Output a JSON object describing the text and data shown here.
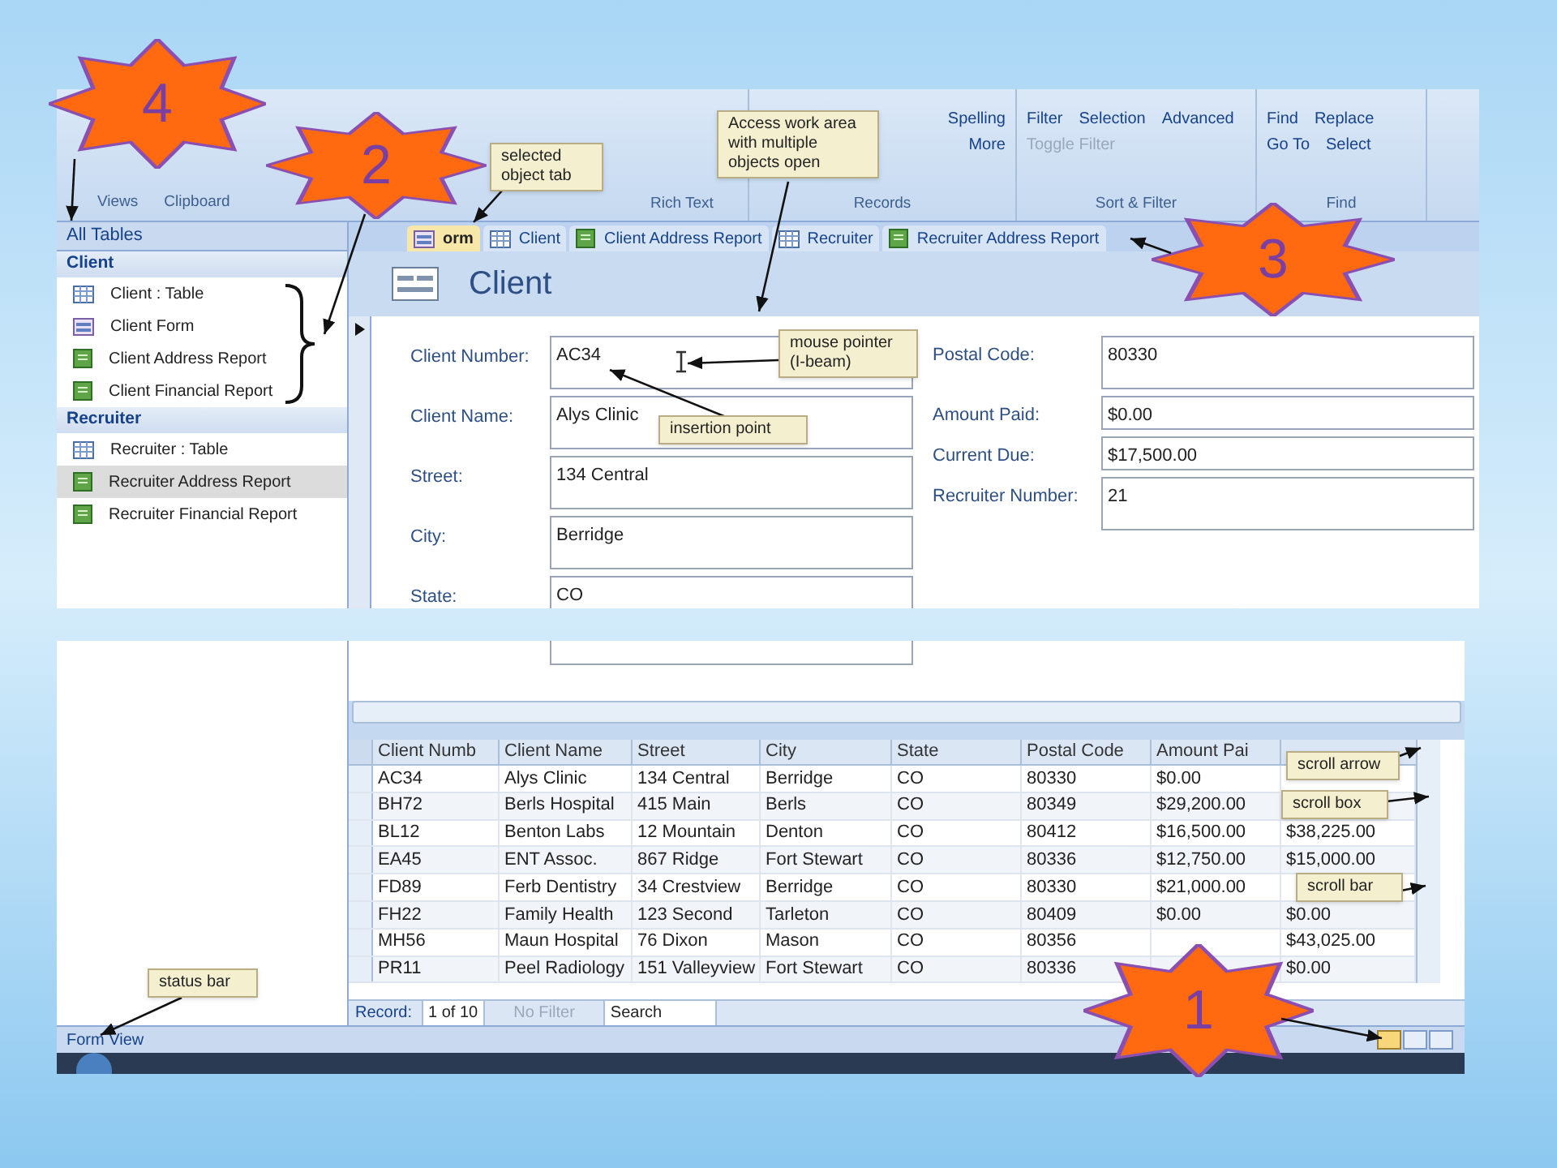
{
  "ribbon": {
    "groups": [
      {
        "label": "Views"
      },
      {
        "label": "Clipboard"
      },
      {
        "label": "Rich Text"
      },
      {
        "label": "Records",
        "buttons": [
          {
            "label": "Spelling",
            "disabled": false
          },
          {
            "label": "More",
            "disabled": false
          }
        ]
      },
      {
        "label": "Sort & Filter",
        "buttons": [
          {
            "label": "Filter",
            "disabled": false
          },
          {
            "label": "Selection",
            "disabled": false
          },
          {
            "label": "Advanced",
            "disabled": false
          },
          {
            "label": "Toggle Filter",
            "disabled": true
          }
        ]
      },
      {
        "label": "Find",
        "buttons": [
          {
            "label": "Find",
            "disabled": false
          },
          {
            "label": "Replace",
            "disabled": false
          },
          {
            "label": "Go To",
            "disabled": false
          },
          {
            "label": "Select",
            "disabled": false
          }
        ]
      }
    ]
  },
  "nav_pane": {
    "title": "All Tables",
    "groups": [
      {
        "label": "Client",
        "items": [
          {
            "label": "Client : Table",
            "kind": "table",
            "selected": false
          },
          {
            "label": "Client Form",
            "kind": "form",
            "selected": false
          },
          {
            "label": "Client Address Report",
            "kind": "report",
            "selected": false
          },
          {
            "label": "Client Financial Report",
            "kind": "report",
            "selected": false
          }
        ]
      },
      {
        "label": "Recruiter",
        "items": [
          {
            "label": "Recruiter : Table",
            "kind": "table",
            "selected": false
          },
          {
            "label": "Recruiter Address Report",
            "kind": "report",
            "selected": true
          },
          {
            "label": "Recruiter Financial Report",
            "kind": "report",
            "selected": false
          }
        ]
      }
    ]
  },
  "tabs": [
    {
      "label": "orm",
      "kind": "form",
      "selected": true
    },
    {
      "label": "Client",
      "kind": "table",
      "selected": false
    },
    {
      "label": "Client Address Report",
      "kind": "report",
      "selected": false
    },
    {
      "label": "Recruiter",
      "kind": "table",
      "selected": false
    },
    {
      "label": "Recruiter Address Report",
      "kind": "report",
      "selected": false
    }
  ],
  "form": {
    "title": "Client",
    "fields_left": [
      {
        "label": "Client Number:",
        "value": "AC34"
      },
      {
        "label": "Client Name:",
        "value": "Alys Clinic"
      },
      {
        "label": "Street:",
        "value": "134 Central"
      },
      {
        "label": "City:",
        "value": "Berridge"
      },
      {
        "label": "State:",
        "value": "CO"
      }
    ],
    "fields_right": [
      {
        "label": "Postal Code:",
        "value": "80330",
        "tall": true
      },
      {
        "label": "Amount Paid:",
        "value": "$0.00",
        "tall": false
      },
      {
        "label": "Current Due:",
        "value": "$17,500.00",
        "tall": false
      },
      {
        "label": "Recruiter Number:",
        "value": "21",
        "tall": true
      }
    ]
  },
  "datasheet": {
    "columns": [
      "Client Numb",
      "Client Name",
      "Street",
      "City",
      "State",
      "Postal Code",
      "Amount Pai",
      null
    ],
    "rows": [
      [
        "AC34",
        "Alys Clinic",
        "134 Central",
        "Berridge",
        "CO",
        "80330",
        "$0.00",
        null
      ],
      [
        "BH72",
        "Berls Hospital",
        "415 Main",
        "Berls",
        "CO",
        "80349",
        "$29,200.00",
        null
      ],
      [
        "BL12",
        "Benton Labs",
        "12 Mountain",
        "Denton",
        "CO",
        "80412",
        "$16,500.00",
        "$38,225.00"
      ],
      [
        "EA45",
        "ENT Assoc.",
        "867 Ridge",
        "Fort Stewart",
        "CO",
        "80336",
        "$12,750.00",
        "$15,000.00"
      ],
      [
        "FD89",
        "Ferb Dentistry",
        "34 Crestview",
        "Berridge",
        "CO",
        "80330",
        "$21,000.00",
        null
      ],
      [
        "FH22",
        "Family Health",
        "123 Second",
        "Tarleton",
        "CO",
        "80409",
        "$0.00",
        "$0.00"
      ],
      [
        "MH56",
        "Maun Hospital",
        "76 Dixon",
        "Mason",
        "CO",
        "80356",
        null,
        "$43,025.00"
      ],
      [
        "PR11",
        "Peel Radiology",
        "151 Valleyview",
        "Fort Stewart",
        "CO",
        "80336",
        null,
        "$0.00"
      ]
    ]
  },
  "record_nav": {
    "label": "Record:",
    "position": "1 of 10",
    "filter": "No Filter",
    "search": "Search"
  },
  "status_bar": {
    "text": "Form View"
  },
  "callouts": [
    {
      "text": "selected object tab"
    },
    {
      "text": "Access work area with multiple objects open"
    },
    {
      "text": "mouse pointer (I-beam)"
    },
    {
      "text": "insertion point"
    },
    {
      "text": "scroll arrow"
    },
    {
      "text": "scroll box"
    },
    {
      "text": "scroll bar"
    },
    {
      "text": "status bar"
    }
  ],
  "stars": [
    {
      "text": "4"
    },
    {
      "text": "2"
    },
    {
      "text": "3"
    },
    {
      "text": "1"
    }
  ]
}
